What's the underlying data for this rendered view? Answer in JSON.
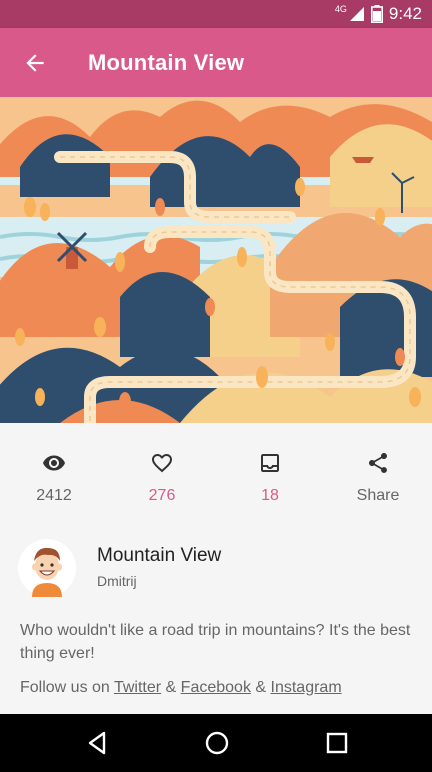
{
  "status_bar": {
    "network": "4G",
    "time": "9:42"
  },
  "app_bar": {
    "title": "Mountain View",
    "back_icon": "arrow-left-icon"
  },
  "hero": {
    "icon": "mountain-illustration"
  },
  "stats": {
    "views": {
      "icon": "eye-icon",
      "value": "2412"
    },
    "likes": {
      "icon": "heart-icon",
      "value": "276"
    },
    "saves": {
      "icon": "inbox-icon",
      "value": "18"
    },
    "share": {
      "icon": "share-icon",
      "label": "Share"
    }
  },
  "author": {
    "name": "Mountain View",
    "handle": "Dmitrij"
  },
  "description": "Who wouldn't like a road trip in mountains? It's the best thing ever!",
  "follow": {
    "prefix": "Follow us on ",
    "twitter": "Twitter",
    "sep1": " & ",
    "facebook": "Facebook",
    "sep2": " & ",
    "instagram": "Instagram"
  },
  "colors": {
    "primary": "#d9598a",
    "primary_dark": "#a83a66"
  }
}
